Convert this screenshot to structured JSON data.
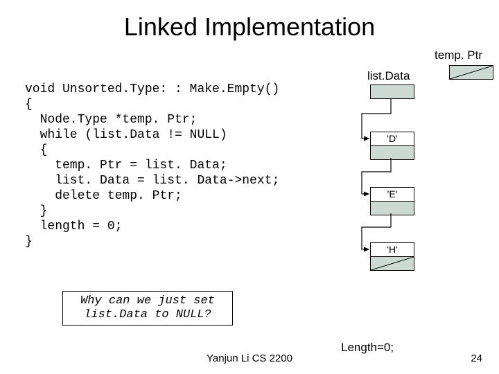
{
  "title": "Linked Implementation",
  "labels": {
    "tempPtr": "temp. Ptr",
    "listData": "list.Data",
    "length": "Length=0;"
  },
  "code": "void Unsorted.Type: : Make.Empty()\n{\n  Node.Type *temp. Ptr;\n  while (list.Data != NULL)\n  {\n    temp. Ptr = list. Data;\n    list. Data = list. Data->next;\n    delete temp. Ptr;\n  }\n  length = 0;\n}",
  "whyBox": {
    "line1": "Why can we just set",
    "line2": "list.Data to NULL?"
  },
  "nodes": {
    "d": "'D'",
    "e": "'E'",
    "h": "'H'"
  },
  "footer": {
    "center": "Yanjun Li CS 2200",
    "slideNum": "24"
  },
  "chart_data": {
    "type": "table",
    "title": "Linked list diagram",
    "pointers": [
      "temp.Ptr",
      "list.Data"
    ],
    "nodes": [
      "'D'",
      "'E'",
      "'H'"
    ],
    "lengthAfter": 0
  }
}
